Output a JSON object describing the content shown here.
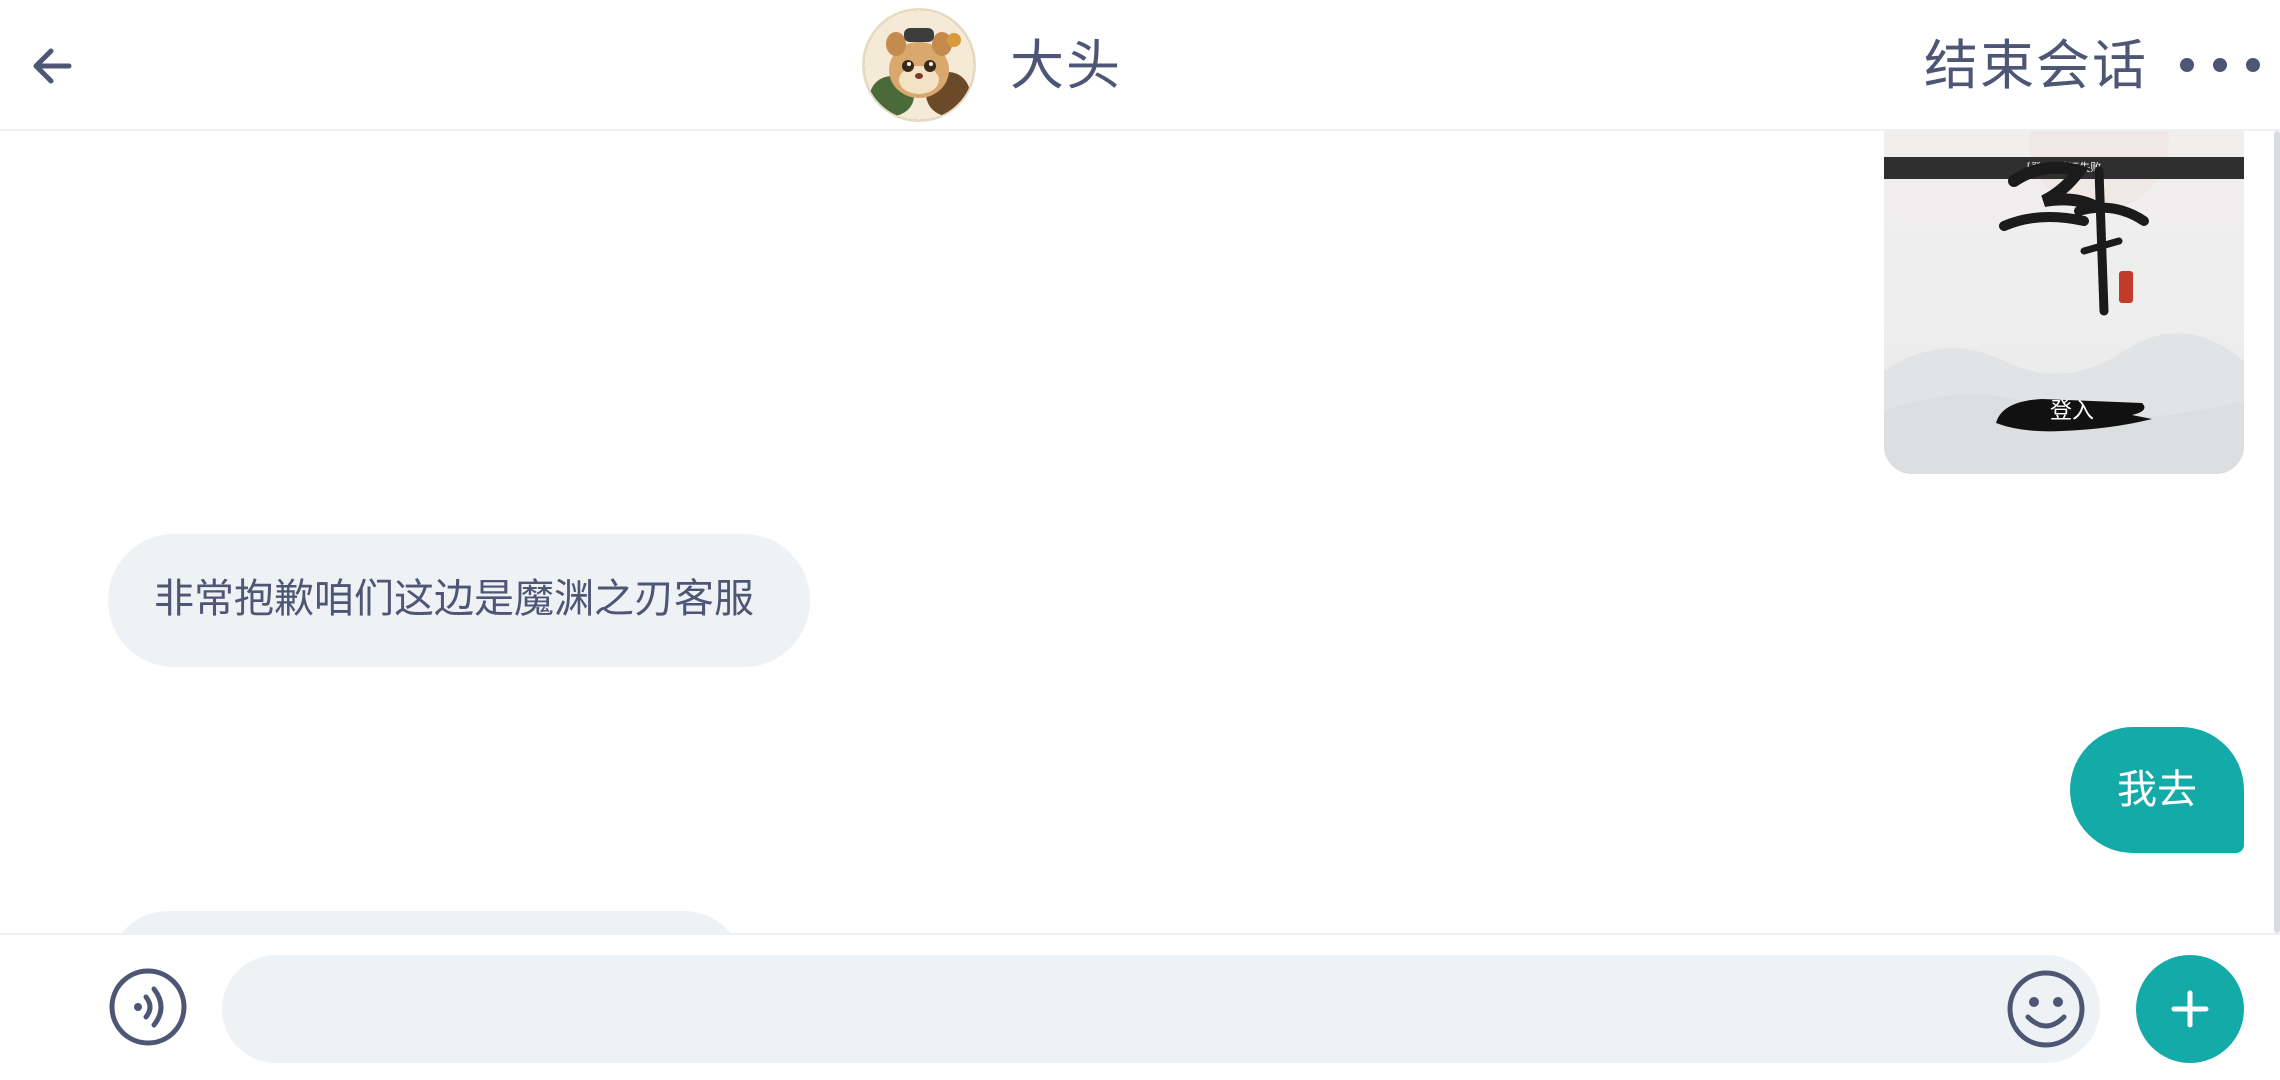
{
  "header": {
    "back_icon": "arrow-left-icon",
    "contact_name": "大头",
    "end_session_label": "结束会话",
    "more_icon": "more-dots-icon"
  },
  "messages": [
    {
      "type": "image",
      "direction": "outgoing",
      "image_caption_top": "[登录]验证失败",
      "image_button_text": "登入"
    },
    {
      "type": "text",
      "direction": "incoming",
      "text": "非常抱歉咱们这边是魔渊之刃客服"
    },
    {
      "type": "text",
      "direction": "outgoing",
      "text": "我去"
    }
  ],
  "input_bar": {
    "voice_icon": "voice-icon",
    "message_placeholder": "",
    "emoji_icon": "emoji-icon",
    "plus_icon": "plus-icon"
  },
  "colors": {
    "accent": "#13aaa8",
    "text": "#4e5675",
    "incoming_bubble": "#eff2f5"
  }
}
